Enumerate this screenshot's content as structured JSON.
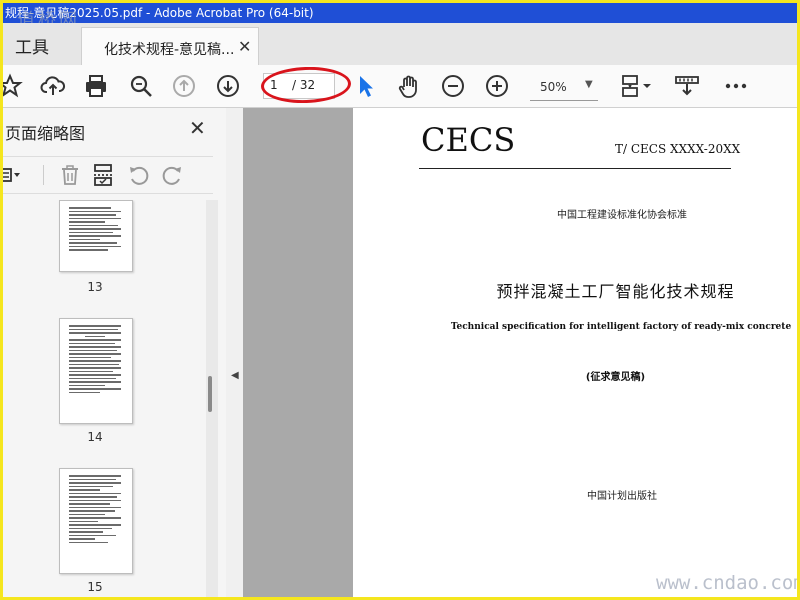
{
  "window": {
    "title": "规程-意见稿2025.05.pdf - Adobe Acrobat Pro (64-bit)",
    "watermark_top": "道桥网"
  },
  "tabs": {
    "tools_label": "工具",
    "document_label": "化技术规程-意见稿...",
    "close_glyph": "✕"
  },
  "toolbar": {
    "icons": [
      "star-icon",
      "cloud-upload-icon",
      "print-icon",
      "zoom-search-icon",
      "page-up-icon",
      "page-down-icon",
      "select-cursor-icon",
      "hand-icon",
      "zoom-out-icon",
      "zoom-in-icon",
      "page-layout-icon",
      "scrolling-mode-icon",
      "more-icon"
    ],
    "page_current": "1",
    "page_total": "/ 32",
    "zoom_value": "50%",
    "highlight_color": "#d9141c"
  },
  "sidebar": {
    "title": "页面缩略图",
    "close_glyph": "✕",
    "tools": [
      "options-menu-icon",
      "delete-page-icon",
      "insert-page-icon",
      "rotate-left-icon",
      "rotate-right-icon"
    ],
    "thumbnails": [
      {
        "page_number": "13"
      },
      {
        "page_number": "14"
      },
      {
        "page_number": "15"
      }
    ]
  },
  "document": {
    "logo": "CECS",
    "standard_number": "T/ CECS  XXXX-20XX",
    "association": "中国工程建设标准化协会标准",
    "title_cn": "预拌混凝土工厂智能化技术规程",
    "title_en": "Technical specification for intelligent factory of ready-mix concrete",
    "subtitle": "(征求意见稿)",
    "publisher": "中国计划出版社"
  },
  "watermark_bottom": "www.cndao.com",
  "colors": {
    "titlebar": "#1f4fd6",
    "frame_border": "#f5e61e",
    "select_cursor": "#1a73e8"
  }
}
